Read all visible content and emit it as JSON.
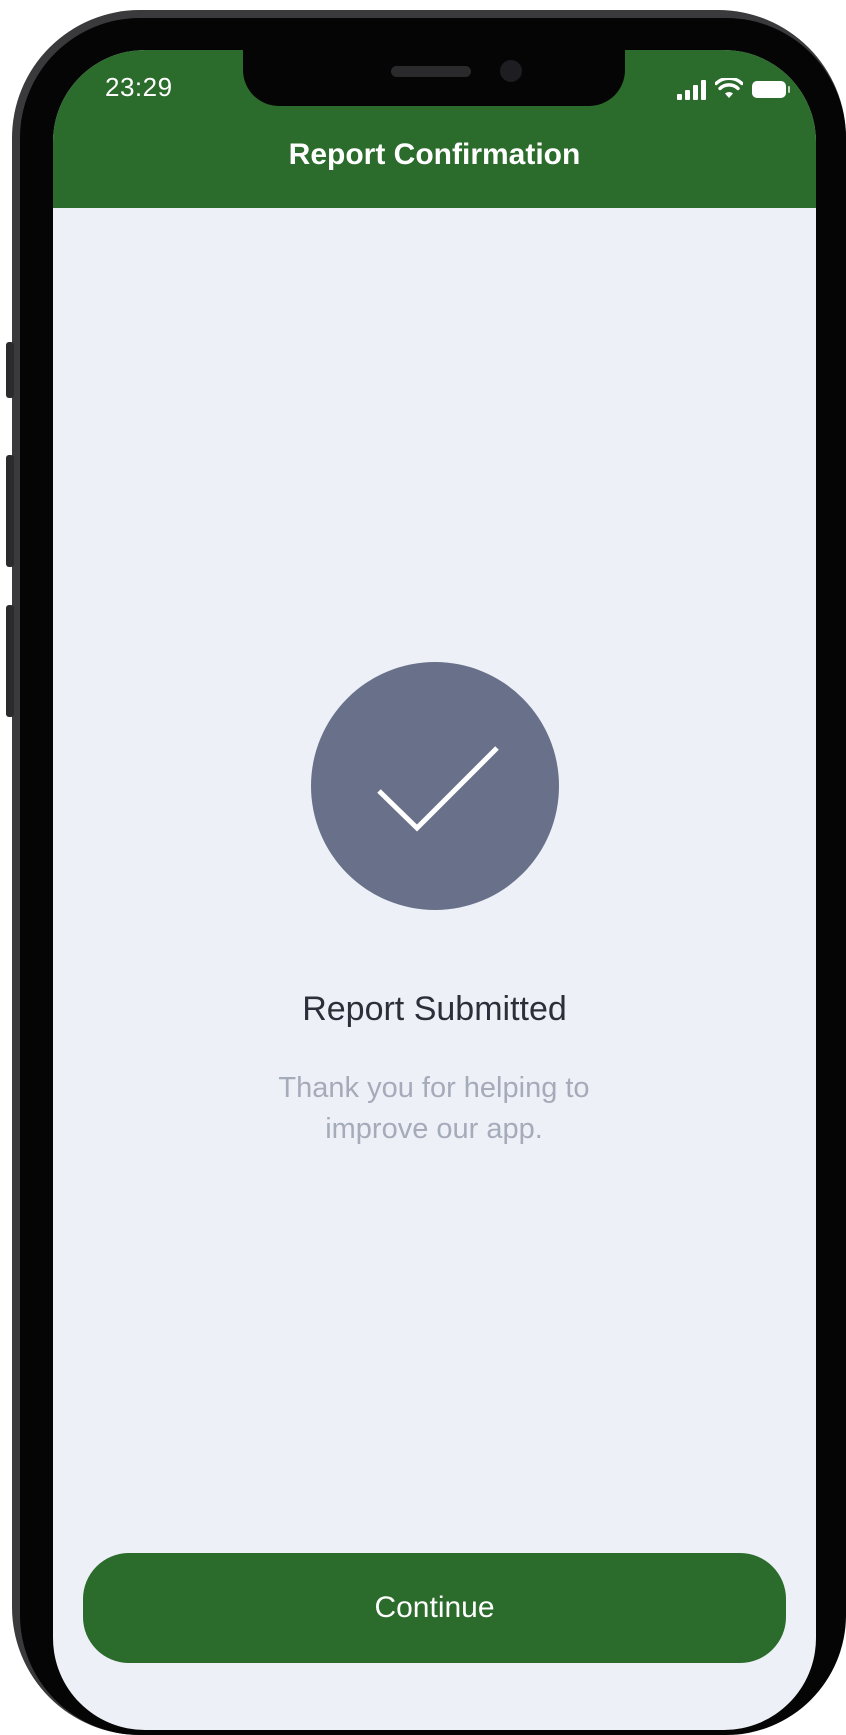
{
  "status_bar": {
    "time": "23:29",
    "icons": [
      "cellular-signal-icon",
      "wifi-icon",
      "battery-icon"
    ]
  },
  "header": {
    "title": "Report Confirmation",
    "background_color": "#2b6b2b"
  },
  "confirmation": {
    "icon": "checkmark-icon",
    "icon_color": "#687189",
    "title": "Report Submitted",
    "message": "Thank you for helping to improve our app."
  },
  "actions": {
    "continue_label": "Continue",
    "button_color": "#2b6b2b"
  }
}
